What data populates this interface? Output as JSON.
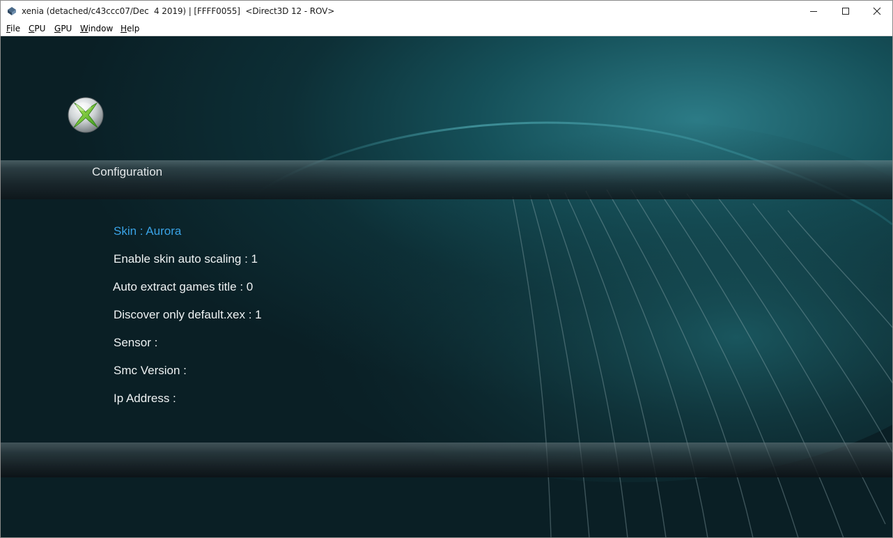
{
  "window": {
    "title": "xenia (detached/c43ccc07/Dec  4 2019) | [FFFF0055]  <Direct3D 12 - ROV>",
    "controls": [
      "minimize-icon",
      "maximize-icon",
      "close-icon"
    ]
  },
  "menu": [
    {
      "label": "File",
      "accel": "F",
      "rest": "ile"
    },
    {
      "label": "CPU",
      "accel": "C",
      "rest": "PU"
    },
    {
      "label": "GPU",
      "accel": "G",
      "rest": "PU"
    },
    {
      "label": "Window",
      "accel": "W",
      "rest": "indow"
    },
    {
      "label": "Help",
      "accel": "H",
      "rest": "elp"
    }
  ],
  "dashboard": {
    "logo": "xbox-logo-icon",
    "section_title": "Configuration",
    "options": [
      {
        "label": "Skin : Aurora",
        "selected": true
      },
      {
        "label": "Enable skin auto scaling : 1",
        "selected": false
      },
      {
        "label": "Auto extract games title : 0",
        "selected": false
      },
      {
        "label": "Discover only default.xex : 1",
        "selected": false
      },
      {
        "label": "Sensor :",
        "selected": false
      },
      {
        "label": "Smc Version :",
        "selected": false
      },
      {
        "label": "Ip Address :",
        "selected": false
      }
    ]
  },
  "colors": {
    "selected_option": "#3aa3e6",
    "option_text": "#eef2f3",
    "background_dark": "#0a1f25",
    "background_glow": "#2c7b86"
  }
}
